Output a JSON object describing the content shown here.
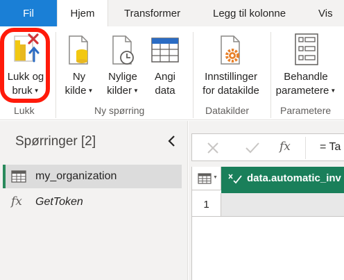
{
  "tabs": [
    {
      "label": "Fil"
    },
    {
      "label": "Hjem"
    },
    {
      "label": "Transformer"
    },
    {
      "label": "Legg til kolonne"
    },
    {
      "label": "Vis"
    }
  ],
  "ribbon": {
    "close_apply": {
      "line1": "Lukk og",
      "line2": "bruk",
      "icon": "close-apply-icon"
    },
    "new_source": {
      "line1": "Ny",
      "line2": "kilde",
      "icon": "new-source-icon"
    },
    "recent_sources": {
      "line1": "Nylige",
      "line2": "kilder",
      "icon": "recent-sources-icon"
    },
    "enter_data": {
      "line1": "Angi",
      "line2": "data",
      "icon": "table-icon"
    },
    "datasource_settings": {
      "line1": "Innstillinger",
      "line2": "for datakilde",
      "icon": "settings-gear-icon"
    },
    "manage_parameters": {
      "line1": "Behandle",
      "line2": "parametere",
      "icon": "parameters-icon"
    },
    "groups": {
      "close": "Lukk",
      "new_query": "Ny spørring",
      "data_sources": "Datakilder",
      "parameters": "Parametere"
    }
  },
  "queries_pane": {
    "title": "Spørringer [2]",
    "items": [
      {
        "label": "my_organization",
        "icon": "table-icon",
        "selected": true
      },
      {
        "label": "GetToken",
        "icon": "fx-icon",
        "selected": false
      }
    ]
  },
  "formula_bar": {
    "fx_label": "fx",
    "text": "= Ta"
  },
  "grid": {
    "column_header": "data.automatic_inv",
    "rows": [
      "1"
    ]
  },
  "colors": {
    "file_tab": "#1a7fd6",
    "accent_green": "#1a7f5a",
    "highlight_ring": "#ff1a0a"
  }
}
